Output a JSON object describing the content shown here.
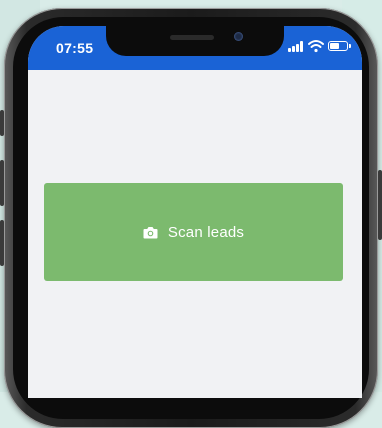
{
  "status_bar": {
    "time": "07:55",
    "signal_icon": "cellular-signal-icon",
    "wifi_icon": "wifi-icon",
    "battery_icon": "battery-icon",
    "battery_level": 0.6,
    "background_color": "#1a63d6"
  },
  "main": {
    "scan_button": {
      "label": "Scan leads",
      "icon": "camera-icon",
      "color": "#7cba6e"
    },
    "background_color": "#f1f2f4"
  }
}
